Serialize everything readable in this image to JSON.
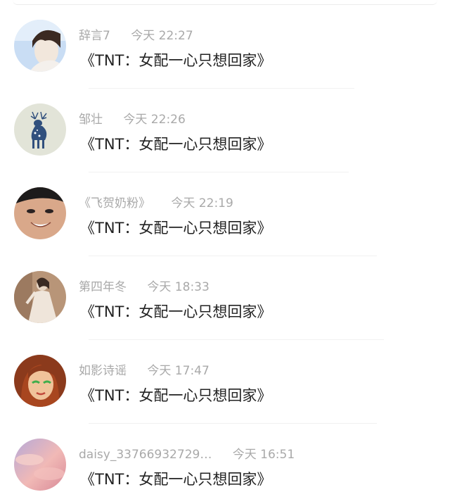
{
  "comments": [
    {
      "username": "辞言7",
      "time": "今天 22:27",
      "text": "《TNT：女配一心只想回家》",
      "avatar": "avatar-anime-boy",
      "colors": [
        "#c9ddf4",
        "#f2e7dc",
        "#3b2a22"
      ]
    },
    {
      "username": "邹壮",
      "time": "今天 22:26",
      "text": "《TNT：女配一心只想回家》",
      "avatar": "avatar-deer",
      "colors": [
        "#e2e4d8",
        "#31507d",
        "#ffffff"
      ]
    },
    {
      "username": "《飞贺奶粉》",
      "time": "今天 22:19",
      "text": "《TNT：女配一心只想回家》",
      "avatar": "avatar-face",
      "colors": [
        "#d9a88a",
        "#1d1b1b",
        "#ffffff"
      ]
    },
    {
      "username": "第四年冬",
      "time": "今天 18:33",
      "text": "《TNT：女配一心只想回家》",
      "avatar": "avatar-girl-dress",
      "colors": [
        "#b89578",
        "#efe5da",
        "#3a2a22"
      ]
    },
    {
      "username": "如影诗谣",
      "time": "今天 17:47",
      "text": "《TNT：女配一心只想回家》",
      "avatar": "avatar-cartoon-woman",
      "colors": [
        "#8b3a1c",
        "#f0c39a",
        "#3fae4b"
      ]
    },
    {
      "username": "daisy_33766932729…",
      "time": "今天 16:51",
      "text": "《TNT：女配一心只想回家》",
      "avatar": "avatar-pink-sky",
      "colors": [
        "#f1b9b6",
        "#b6a9d8",
        "#d88997"
      ]
    }
  ]
}
